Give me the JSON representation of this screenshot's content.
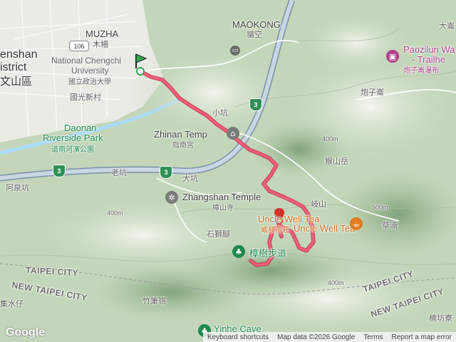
{
  "labels": {
    "muzha_en": "MUZHA",
    "muzha_zh": "木柵",
    "maokong_en": "MAOKONG",
    "maokong_zh": "貓空",
    "wenshan1": "enshan",
    "wenshan2": "istrict",
    "wenshan_zh": "文山區",
    "nccu_en1": "National Chengchi",
    "nccu_en2": "University",
    "nccu_zh": "國立政治大學",
    "guoguang": "國光新村",
    "daonan1": "Daonan",
    "daonan2": "Riverside Park",
    "daonan_zh": "道南河濱公園",
    "xiaokeng": "小坑",
    "zhinan_en": "Zhinan Temp",
    "zhinan_zh": "指南宮",
    "laokeng": "老坑",
    "dakeng": "大坑",
    "aquankeng": "阿泉坑",
    "zhangshan_en": "Zhangshan Temple",
    "zhangshan_zh": "樟山寺",
    "houshanyue": "猴山岳",
    "qishan": "岐山",
    "paoziliao": "炮子崙",
    "paozilun_en1": "Paozilun Wa",
    "paozilun_en2": "- Trailhe",
    "paozilun_zh": "炮子崙瀑布",
    "dajun": "大崙",
    "uncle_en": "Uncle Well Tea",
    "uncle_en2": "U",
    "uncle_zh": "威叔茶莊",
    "caodi": "草湳",
    "shishijiao": "石獅腳",
    "zhangshu_trail": "樟樹步道",
    "taipei_city1": "TAIPEI CITY",
    "taipei_city2": "TAIPEI CITY",
    "new_taipei1": "NEW TAIPEI CITY",
    "new_taipei2": "NEW TAIPEI CITY",
    "zhubiling": "竹筆嶺",
    "yinhe": "Yinhe Cave",
    "jishui": "集水仔",
    "nanfang": "楠坊寮",
    "dadai": "大崙",
    "elev1": "400m",
    "elev2": "500m",
    "elev3": "400m",
    "elev4": "400m"
  },
  "road_shields": {
    "r106": "106",
    "r3a": "3",
    "r3b": "3",
    "r3c": "3",
    "r3d": "3"
  },
  "footer": {
    "shortcuts": "Keyboard shortcuts",
    "mapdata": "Map data ©2026 Google",
    "terms": "Terms",
    "report": "Report a map error"
  },
  "logo": "Google",
  "colors": {
    "route": "#f0607a",
    "route_outline": "#c8374f",
    "start_marker": "#35a852",
    "end_marker": "#d93025"
  }
}
